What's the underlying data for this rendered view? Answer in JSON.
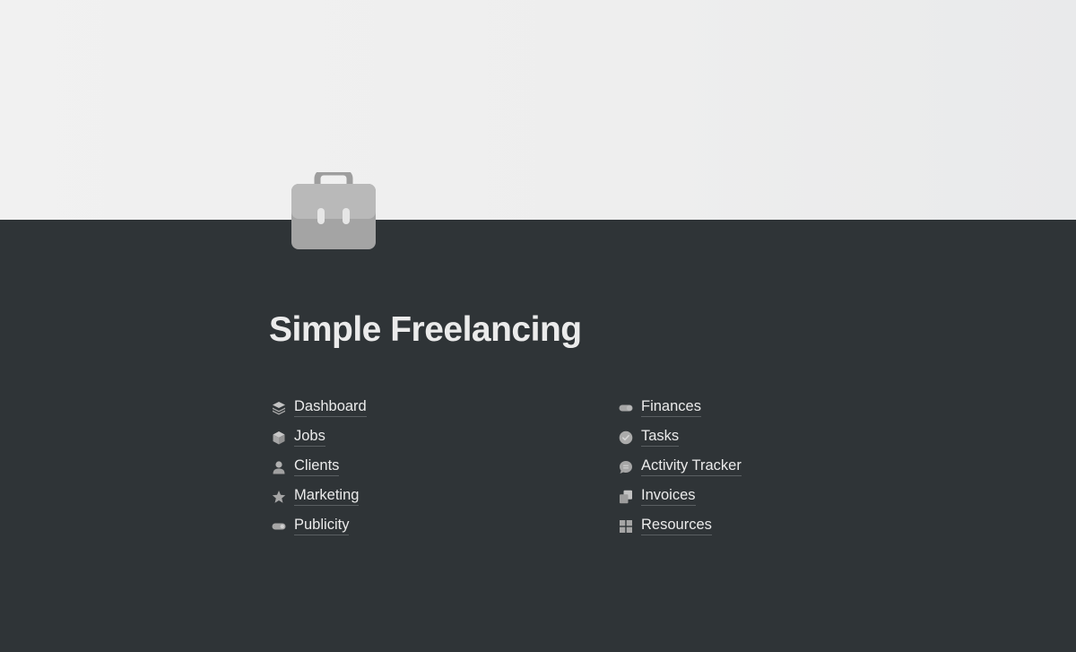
{
  "page": {
    "title": "Simple Freelancing",
    "icon": "briefcase-icon"
  },
  "links": {
    "left": [
      {
        "label": "Dashboard",
        "icon": "layers-icon"
      },
      {
        "label": "Jobs",
        "icon": "cube-icon"
      },
      {
        "label": "Clients",
        "icon": "person-icon"
      },
      {
        "label": "Marketing",
        "icon": "star-icon"
      },
      {
        "label": "Publicity",
        "icon": "toggle-icon"
      }
    ],
    "right": [
      {
        "label": "Finances",
        "icon": "pill-icon"
      },
      {
        "label": "Tasks",
        "icon": "checkmark-circle-icon"
      },
      {
        "label": "Activity Tracker",
        "icon": "chat-bubble-icon"
      },
      {
        "label": "Invoices",
        "icon": "copy-icon"
      },
      {
        "label": "Resources",
        "icon": "grid-icon"
      }
    ]
  },
  "colors": {
    "background": "#2f3437",
    "text": "#ebebeb",
    "icon": "#a6a6a6"
  }
}
